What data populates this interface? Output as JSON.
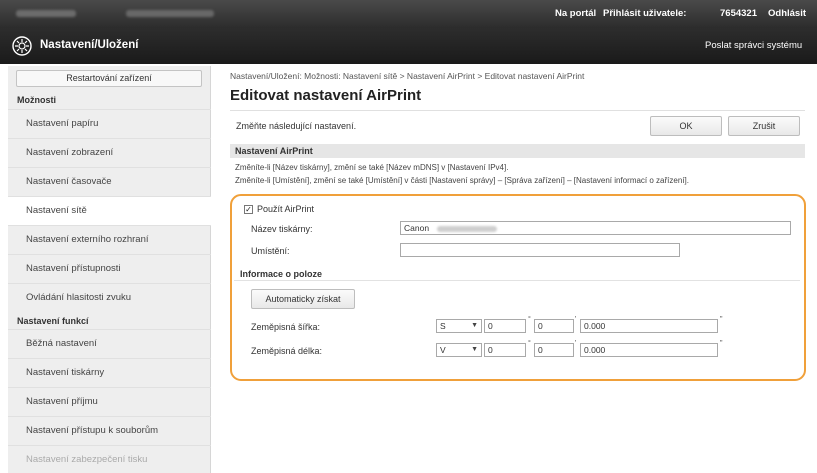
{
  "topbar": {
    "portal": "Na portál",
    "login": "Přihlásit uživatele:",
    "user_id": "7654321",
    "logout": "Odhlásit"
  },
  "header": {
    "title": "Nastavení/Uložení",
    "mail_admin": "Poslat správci systému"
  },
  "sidebar": {
    "restart_button": "Restartování zařízení",
    "section_moznosti": "Možnosti",
    "items_moznosti": [
      "Nastavení papíru",
      "Nastavení zobrazení",
      "Nastavení časovače",
      "Nastavení sítě",
      "Nastavení externího rozhraní",
      "Nastavení přístupnosti",
      "Ovládání hlasitosti zvuku"
    ],
    "section_funkce": "Nastavení funkcí",
    "items_funkce": [
      "Běžná nastavení",
      "Nastavení tiskárny",
      "Nastavení příjmu",
      "Nastavení přístupu k souborům",
      "Nastavení zabezpečení tisku"
    ]
  },
  "main": {
    "breadcrumb": "Nastavení/Uložení: Možnosti: Nastavení sítě > Nastavení AirPrint > Editovat nastavení AirPrint",
    "page_title": "Editovat nastavení AirPrint",
    "instruction": "Změňte následující nastavení.",
    "ok_button": "OK",
    "cancel_button": "Zrušit",
    "section_title": "Nastavení AirPrint",
    "note_line1": "Změníte-li [Název tiskárny], změní se také [Název mDNS] v [Nastavení IPv4].",
    "note_line2": "Změníte-li [Umístění], změní se také [Umístění] v části [Nastavení správy] – [Správa zařízení] – [Nastavení informací o zařízení].",
    "use_airprint_label": "Použít AirPrint",
    "use_airprint_checked": true,
    "printer_name_label": "Název tiskárny:",
    "printer_name_value": "Canon",
    "location_label": "Umístění:",
    "location_value": "",
    "location_info_title": "Informace o poloze",
    "auto_get_button": "Automaticky získat",
    "latitude_label": "Zeměpisná šířka:",
    "latitude": {
      "dir": "S",
      "deg": "0",
      "min": "0",
      "sec": "0.000"
    },
    "longitude_label": "Zeměpisná délka:",
    "longitude": {
      "dir": "V",
      "deg": "0",
      "min": "0",
      "sec": "0.000"
    },
    "degree_mark": "°",
    "minute_mark": "'",
    "second_mark": "\""
  },
  "colors": {
    "highlight": "#f0a03a",
    "header_dark": "#1f1f1f",
    "sidebar_bg": "#eeeeee"
  }
}
